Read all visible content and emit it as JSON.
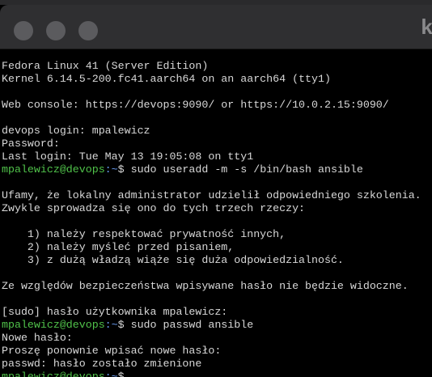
{
  "window": {
    "title": "ki"
  },
  "terminal": {
    "lines": [
      {
        "text": "Fedora Linux 41 (Server Edition)"
      },
      {
        "text": "Kernel 6.14.5-200.fc41.aarch64 on an aarch64 (tty1)"
      },
      {
        "text": ""
      },
      {
        "text": "Web console: https://devops:9090/ or https://10.0.2.15:9090/"
      },
      {
        "text": ""
      },
      {
        "text": "devops login: mpalewicz"
      },
      {
        "text": "Password:"
      },
      {
        "text": "Last login: Tue May 13 19:05:08 on tty1"
      },
      {
        "prompt_user": "mpalewicz@devops",
        "prompt_path": ":~",
        "text": "$ sudo useradd -m -s /bin/bash ansible"
      },
      {
        "text": ""
      },
      {
        "text": "Ufamy, że lokalny administrator udzielił odpowiedniego szkolenia."
      },
      {
        "text": "Zwykle sprowadza się ono do tych trzech rzeczy:"
      },
      {
        "text": ""
      },
      {
        "text": "    1) należy respektować prywatność innych,"
      },
      {
        "text": "    2) należy myśleć przed pisaniem,"
      },
      {
        "text": "    3) z dużą władzą wiąże się duża odpowiedzialność."
      },
      {
        "text": ""
      },
      {
        "text": "Ze względów bezpieczeństwa wpisywane hasło nie będzie widoczne."
      },
      {
        "text": ""
      },
      {
        "text": "[sudo] hasło użytkownika mpalewicz:"
      },
      {
        "prompt_user": "mpalewicz@devops",
        "prompt_path": ":~",
        "text": "$ sudo passwd ansible"
      },
      {
        "text": "Nowe hasło:"
      },
      {
        "text": "Proszę ponownie wpisać nowe hasło:"
      },
      {
        "text": "passwd: hasło zostało zmienione"
      },
      {
        "prompt_user": "mpalewicz@devops",
        "prompt_path": ":~",
        "text": "$"
      }
    ]
  }
}
